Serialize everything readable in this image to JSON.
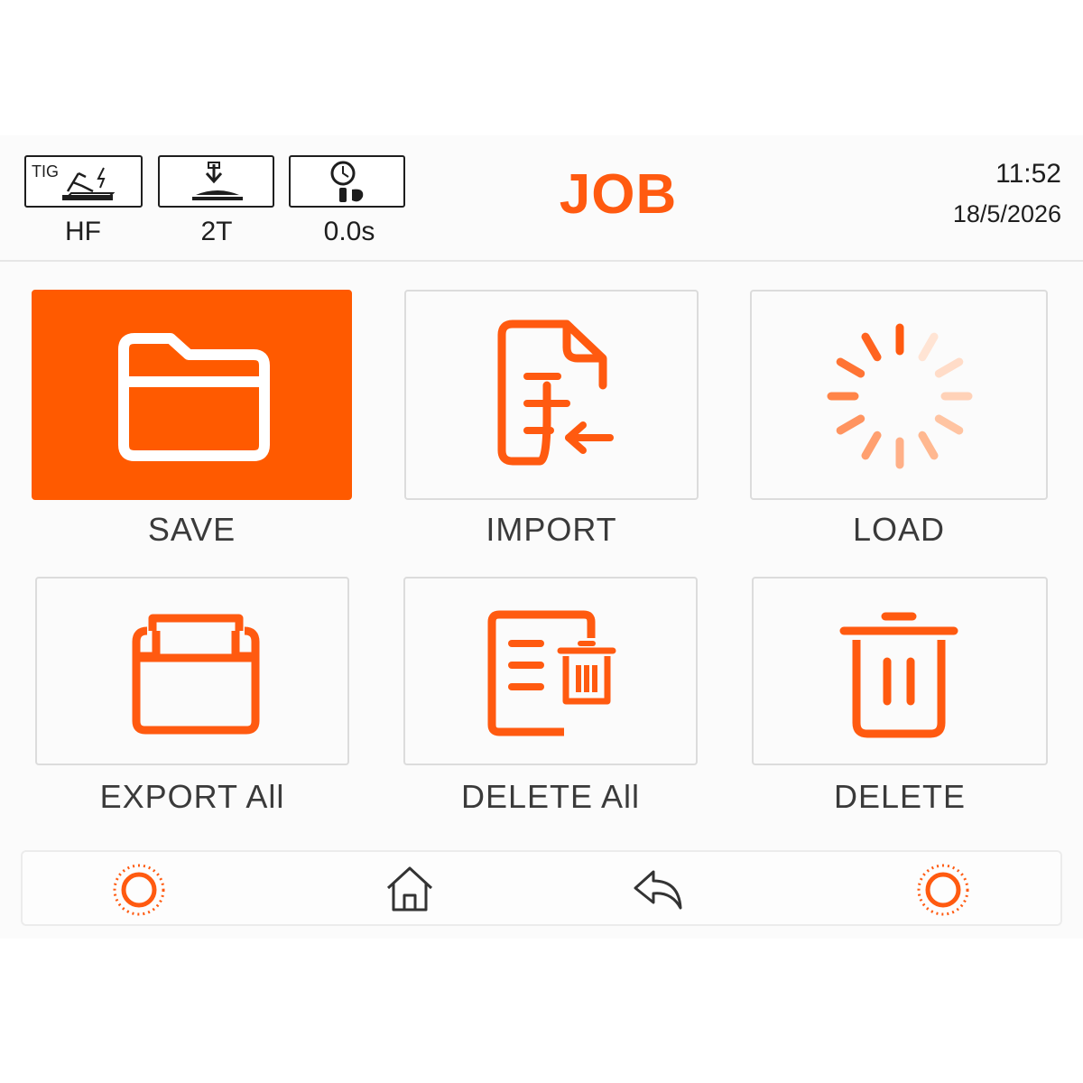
{
  "header": {
    "title": "JOB",
    "time": "11:52",
    "date": "18/5/2026",
    "modes": [
      {
        "icon": "tig-torch-icon",
        "badge": "TIG",
        "label": "HF"
      },
      {
        "icon": "trigger-mode-icon",
        "label": "2T"
      },
      {
        "icon": "gas-timer-icon",
        "label": "0.0s"
      }
    ]
  },
  "tiles": [
    {
      "icon": "folder-icon",
      "label": "SAVE",
      "active": true
    },
    {
      "icon": "import-file-icon",
      "label": "IMPORT",
      "active": false
    },
    {
      "icon": "loading-spinner-icon",
      "label": "LOAD",
      "active": false
    },
    {
      "icon": "export-folder-icon",
      "label": "EXPORT All",
      "active": false
    },
    {
      "icon": "delete-all-document-icon",
      "label": "DELETE All",
      "active": false
    },
    {
      "icon": "trash-icon",
      "label": "DELETE",
      "active": false
    }
  ],
  "nav": [
    {
      "icon": "brightness-left-icon"
    },
    {
      "icon": "home-icon"
    },
    {
      "icon": "back-arrow-icon"
    },
    {
      "icon": "brightness-right-icon"
    }
  ],
  "colors": {
    "accent": "#ff5a00",
    "text": "#3a3a3a",
    "border": "#dcdcdc"
  }
}
